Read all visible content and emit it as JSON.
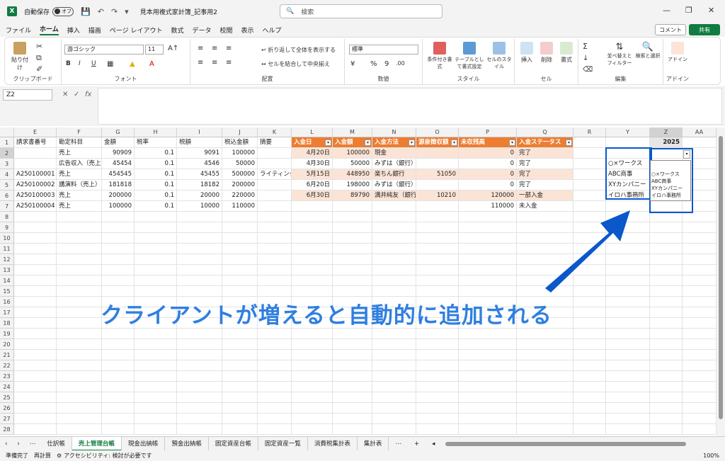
{
  "titlebar": {
    "autosave": "自動保存",
    "toggle": "オフ",
    "title": "見本用複式家計簿_記事用2",
    "search": "検索"
  },
  "menu": [
    "ファイル",
    "ホーム",
    "挿入",
    "描画",
    "ページ レイアウト",
    "数式",
    "データ",
    "校閲",
    "表示",
    "ヘルプ"
  ],
  "menu_buttons": {
    "comment": "コメント",
    "share": "共有"
  },
  "ribbon": {
    "clipboard": {
      "paste": "貼り付け",
      "label": "クリップボード"
    },
    "font": {
      "name": "游ゴシック",
      "size": "11",
      "label": "フォント"
    },
    "align": {
      "wrap": "折り返して全体を表示する",
      "merge": "セルを結合して中央揃え",
      "label": "配置"
    },
    "number": {
      "format": "標準",
      "label": "数値"
    },
    "style": {
      "cond": "条件付き書式",
      "table": "テーブルとして書式設定",
      "cellstyle": "セルのスタイル",
      "label": "スタイル"
    },
    "cells": {
      "insert": "挿入",
      "delete": "削除",
      "format": "書式",
      "label": "セル"
    },
    "edit": {
      "sort": "並べ替えとフィルター",
      "find": "検索と選択",
      "label": "編集"
    },
    "addin": {
      "addin": "アドイン",
      "label": "アドイン"
    }
  },
  "formula": {
    "namebox": "Z2",
    "fx": "fx"
  },
  "columns": [
    "E",
    "F",
    "G",
    "H",
    "I",
    "J",
    "K",
    "L",
    "M",
    "N",
    "O",
    "P",
    "Q",
    "R",
    "Y",
    "Z",
    "AA"
  ],
  "rows": [
    "1",
    "2",
    "3",
    "4",
    "5",
    "6",
    "7",
    "8",
    "9",
    "10",
    "11",
    "12",
    "13",
    "14",
    "15",
    "16",
    "17",
    "18",
    "19",
    "20",
    "21",
    "22",
    "23",
    "24",
    "25",
    "26",
    "27",
    "28"
  ],
  "left_table": {
    "headers": [
      "請求書番号",
      "勘定科目",
      "金額",
      "税率",
      "税額",
      "税込金額",
      "摘要"
    ],
    "rows": [
      [
        "",
        "売上",
        "90909",
        "0.1",
        "9091",
        "100000",
        ""
      ],
      [
        "",
        "広告収入（売上）",
        "45454",
        "0.1",
        "4546",
        "50000",
        ""
      ],
      [
        "A250100001",
        "売上",
        "454545",
        "0.1",
        "45455",
        "500000",
        "ライティング"
      ],
      [
        "A250100002",
        "講演料（売上）",
        "181818",
        "0.1",
        "18182",
        "200000",
        ""
      ],
      [
        "A250100003",
        "売上",
        "200000",
        "0.1",
        "20000",
        "220000",
        ""
      ],
      [
        "A250100004",
        "売上",
        "100000",
        "0.1",
        "10000",
        "110000",
        ""
      ]
    ]
  },
  "right_table": {
    "headers": [
      "入金日",
      "入金額",
      "入金方法",
      "源泉徴収額",
      "未収残高",
      "入金ステータス"
    ],
    "rows": [
      [
        "4月20日",
        "100000",
        "現金",
        "",
        "0",
        "完了"
      ],
      [
        "4月30日",
        "50000",
        "みずは（銀行）",
        "",
        "0",
        "完了"
      ],
      [
        "5月15日",
        "448950",
        "楽ちん銀行",
        "51050",
        "0",
        "完了"
      ],
      [
        "6月20日",
        "198000",
        "みずは（銀行）",
        "",
        "0",
        "完了"
      ],
      [
        "6月30日",
        "89790",
        "満井純友（銀行）",
        "10210",
        "120000",
        "一部入金"
      ],
      [
        "",
        "",
        "",
        "",
        "110000",
        "未入金"
      ]
    ]
  },
  "client_list": {
    "header": "2025",
    "items": [
      "○×ワークス",
      "ABC商事",
      "XYカンパニー",
      "イロハ事務所"
    ]
  },
  "dropdown": {
    "items": [
      "○×ワークス",
      "ABC商事",
      "XYカンパニー",
      "イロハ事務所"
    ]
  },
  "caption": "クライアントが増えると自動的に追加される",
  "sheet_tabs": [
    "仕訳帳",
    "売上管理台帳",
    "現金出納帳",
    "預金出納帳",
    "固定資産台帳",
    "固定資産一覧",
    "消費税集計表",
    "集計表"
  ],
  "status": {
    "ready": "準備完了",
    "recalc": "再計算",
    "access": "アクセシビリティ: 検討が必要です",
    "zoom": "100%"
  },
  "colors": {
    "accent": "#107c41",
    "table_header": "#ed7d31",
    "band": "#fbe4d5",
    "annotation": "#0a58ca"
  }
}
